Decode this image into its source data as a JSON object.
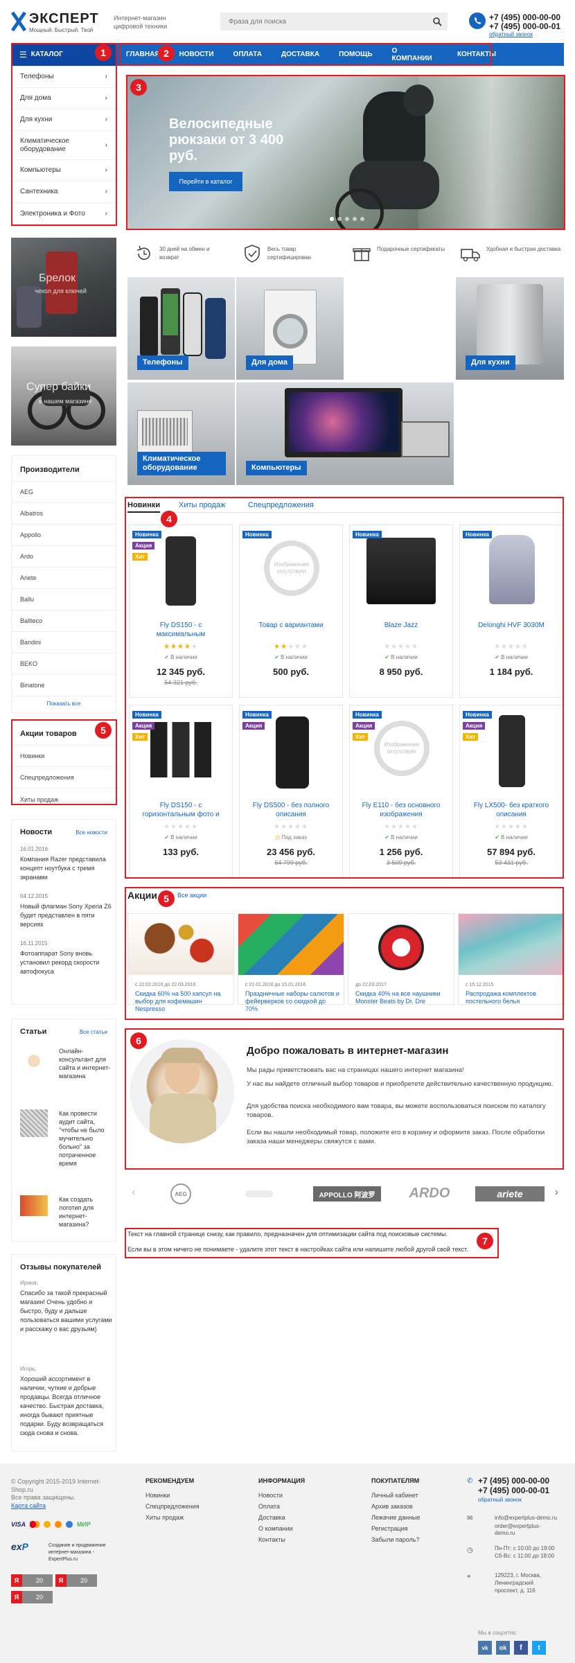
{
  "header": {
    "logo_title": "ЭКСПЕРТ",
    "logo_tagline": "Мощный. Быстрый. Твой",
    "store_desc": "Интернет-магазин цифровой техники",
    "search_placeholder": "Фраза для поиска",
    "phone1": "+7 (495) 000-00-00",
    "phone2": "+7 (495) 000-00-01",
    "callback": "обратный звонок"
  },
  "nav": {
    "catalog": "КАТАЛОГ",
    "items": [
      "ГЛАВНАЯ",
      "НОВОСТИ",
      "ОПЛАТА",
      "ДОСТАВКА",
      "ПОМОЩЬ",
      "О КОМПАНИИ",
      "КОНТАКТЫ"
    ]
  },
  "catalog_menu": [
    "Телефоны",
    "Для дома",
    "Для кухни",
    "Климатическое оборудование",
    "Компьютеры",
    "Сантехника",
    "Электроника и Фото"
  ],
  "banner": {
    "title": "Велосипедные рюкзаки от 3 400 руб.",
    "button": "Перейти в каталог"
  },
  "side_banners": [
    {
      "title": "Брелок",
      "subtitle": "чехол для ключей"
    },
    {
      "title": "Супер байки",
      "subtitle": "в нашем магазине"
    }
  ],
  "features": [
    "30 дней на обмен и возврат",
    "Весь товар сертифицирован",
    "Подарочные сертификаты",
    "Удобная и быстрая доставка"
  ],
  "categories": [
    "Телефоны",
    "Для дома",
    "Для кухни",
    "Климатическое оборудование",
    "Компьютеры"
  ],
  "manufacturers": {
    "title": "Производители",
    "items": [
      "AEG",
      "Albatros",
      "Appollo",
      "Ardo",
      "Ariete",
      "Ballu",
      "Ballteco",
      "Bandini",
      "BEKO",
      "Binatone"
    ],
    "more": "Показать все"
  },
  "promo_menu": {
    "title": "Акции товаров",
    "items": [
      "Новинки",
      "Спецпредложения",
      "Хиты продаж"
    ]
  },
  "product_tabs": [
    "Новинки",
    "Хиты продаж",
    "Спецпредложения"
  ],
  "products": [
    {
      "tags": [
        "Новинка",
        "Акция",
        "Хит"
      ],
      "name": "Fly DS150 - с максимальным",
      "stars": 4,
      "status": "В наличии",
      "price": "12 345 руб.",
      "old": "54 321 руб."
    },
    {
      "tags": [
        "Новинка"
      ],
      "name": "Товар с вариантами",
      "stars": 2,
      "status": "В наличии",
      "price": "500 руб.",
      "old": "",
      "noimage": "Изображение отсутствует"
    },
    {
      "tags": [
        "Новинка"
      ],
      "name": "Blaze Jazz",
      "stars": 0,
      "status": "В наличии",
      "price": "8 950 руб.",
      "old": ""
    },
    {
      "tags": [
        "Новинка"
      ],
      "name": "Delonghi HVF 3030M",
      "stars": 0,
      "status": "В наличии",
      "price": "1 184 руб.",
      "old": ""
    },
    {
      "tags": [
        "Новинка",
        "Акция",
        "Хит"
      ],
      "name": "Fly DS150 - с горизонтальным фото и",
      "stars": 0,
      "status": "В наличии",
      "price": "133 руб.",
      "old": ""
    },
    {
      "tags": [
        "Новинка",
        "Акция"
      ],
      "name": "Fly DS500 - без полного описания",
      "stars": 0,
      "status": "Под заказ",
      "price": "23 456 руб.",
      "old": "64 799 руб."
    },
    {
      "tags": [
        "Новинка",
        "Акция",
        "Хит"
      ],
      "name": "Fly E110 - без основного изображения",
      "stars": 0,
      "status": "В наличии",
      "price": "1 256 руб.",
      "old": "3 509 руб.",
      "noimage": "Изображение отсутствует"
    },
    {
      "tags": [
        "Новинка",
        "Акция",
        "Хит"
      ],
      "name": "Fly LX500- без краткого описания",
      "stars": 0,
      "status": "В наличии",
      "price": "57 894 руб.",
      "old": "53 431 руб."
    }
  ],
  "actions": {
    "title": "Акции",
    "all": "Все акции",
    "items": [
      {
        "date": "с 22.02.2016 до 22.03.2016",
        "title": "Скидка 60% на 500 капсул на выбор для кофемашин Nespresso"
      },
      {
        "date": "с 01.01.2016 до 15.01.2016",
        "title": "Праздничные наборы салютов и фейерверков со скидкой до 70%"
      },
      {
        "date": "до 22.03.2017",
        "title": "Скидка 40% на все наушники Monster Beats by Dr. Dre"
      },
      {
        "date": "с 15.12.2015",
        "title": "Распродажа комплектов постельного белья"
      }
    ]
  },
  "welcome": {
    "title": "Добро пожаловать в интернет-магазин",
    "p1": "Мы рады приветствовать вас на страницах нашего интернет магазина!",
    "p2": "У нас вы найдете отличный выбор товаров и приобретете действительно качественную продукцию.",
    "p3": "Для удобства поиска необходимого вам товара, вы можете воспользоваться поиском по каталогу товаров.",
    "p4": "Если вы нашли необходимый товар, положите его в корзину и оформите заказ. После обработки заказа наши менеджеры свяжутся с вами."
  },
  "brands": [
    "AEG",
    "APPOLLO 阿波罗",
    "ARDO",
    "ariete"
  ],
  "seo": {
    "line1": "Текст на главной странице снизу, как правило, предназначен для оптимизации сайта под поисковые системы.",
    "line2": "Если вы в этом ничего не понимаете - удалите этот текст в настройках сайта или напишите любой другой свой текст."
  },
  "news": {
    "title": "Новости",
    "all": "Все новости",
    "items": [
      {
        "date": "16.01.2016",
        "text": "Компания Razer представила концепт ноутбука с тремя экранами"
      },
      {
        "date": "04.12.2015",
        "text": "Новый флагман Sony Xperia Z6 будет представлен в пяти версиях"
      },
      {
        "date": "16.11.2015",
        "text": "Фотоаппарат Sony вновь установил рекорд скорости автофокуса"
      }
    ]
  },
  "articles": {
    "title": "Статьи",
    "all": "Все статьи",
    "items": [
      "Онлайн-консультант для сайта и интернет-магазина",
      "Как провести аудит сайта, \"чтобы не было мучительно больно\" за потраченное время",
      "Как создать логотип для интернет-магазина?"
    ]
  },
  "reviews": {
    "title": "Отзывы покупателей",
    "items": [
      {
        "author": "Ирина:",
        "text": "Спасибо за такой прекрасный магазин! Очень удобно и быстро, буду и дальше пользоваться вашими услугами и расскажу о вас друзьям)"
      },
      {
        "author": "Игорь:",
        "text": "Хороший ассортимент в наличии, чуткие и добрые продавцы. Всегда отличное качество. Быстрая доставка, иногда бывают приятные подарки. Буду возвращаться сюда снова и снова."
      }
    ]
  },
  "footer": {
    "copyright": "© Copyright 2015-2019 Internet-Shop.ru",
    "rights": "Все права защищены.",
    "sitemap": "Карта сайта",
    "payments": [
      "VISA",
      "МИР"
    ],
    "dev": "Создание и продвижение интернет-магазина - ExpertPlus.ru",
    "counter": "20",
    "cols": [
      {
        "title": "РЕКОМЕНДУЕМ",
        "items": [
          "Новинки",
          "Спецпредложения",
          "Хиты продаж"
        ]
      },
      {
        "title": "ИНФОРМАЦИЯ",
        "items": [
          "Новости",
          "Оплата",
          "Доставка",
          "О компании",
          "Контакты"
        ]
      },
      {
        "title": "ПОКУПАТЕЛЯМ",
        "items": [
          "Личный кабинет",
          "Архив заказов",
          "Лежачие данные",
          "Регистрация",
          "Забыли пароль?"
        ]
      }
    ],
    "phone1": "+7 (495) 000-00-00",
    "phone2": "+7 (495) 000-00-01",
    "callback": "обратный звонок",
    "email1": "info@expertplus-demo.ru",
    "email2": "order@expertplus-demo.ru",
    "hours1": "Пн-Пт: с 10:00 до 19:00",
    "hours2": "Сб-Вс: с 11:00 до 18:00",
    "address": "129223, г. Москва, Ленинградский проспект, д. 116",
    "social_title": "Мы в соцсетях:"
  },
  "annotations": [
    "1",
    "2",
    "3",
    "4",
    "5",
    "5",
    "6",
    "7"
  ],
  "colors": {
    "primary": "#1565c0",
    "annotation": "#e21b22",
    "promo_tag": "#7b3fa0",
    "hit_tag": "#f5b400"
  }
}
